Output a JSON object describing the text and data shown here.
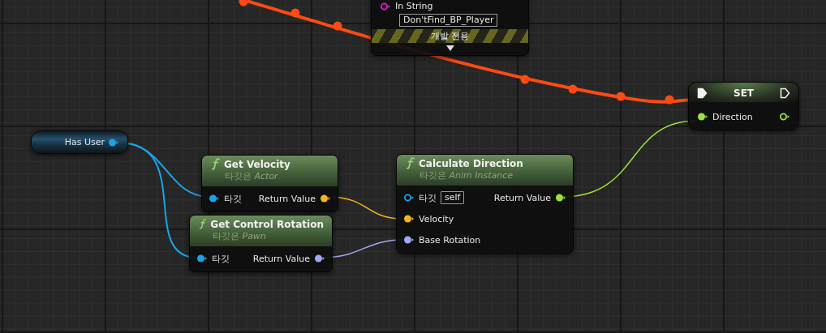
{
  "nodes": [
    {
      "kind": "debug",
      "pin": {
        "label": "In String",
        "color": "#e01ad0",
        "connected": false
      },
      "value": "Don'tFind_BP_Player",
      "banner": "개발 전용"
    },
    {
      "kind": "set",
      "title": "SET",
      "exec_in": {
        "connected": true
      },
      "exec_out": {
        "connected": false
      },
      "pins": [
        {
          "label": "Direction",
          "color": "#9be33a",
          "connected": true,
          "out_connected": false
        }
      ]
    },
    {
      "kind": "variable",
      "title": "Has User",
      "pin": {
        "color": "#1aa3e8",
        "connected": true
      }
    },
    {
      "kind": "function",
      "title": "Get Velocity",
      "subtitle": "타깃은 *Actor*",
      "inputs": [
        {
          "label": "타깃",
          "color": "#1aa3e8",
          "connected": true
        }
      ],
      "outputs": [
        {
          "label": "Return Value",
          "color": "#f5b619",
          "connected": true
        }
      ]
    },
    {
      "kind": "function",
      "title": "Get Control Rotation",
      "subtitle": "타깃은 *Pawn*",
      "inputs": [
        {
          "label": "타깃",
          "color": "#1aa3e8",
          "connected": true
        }
      ],
      "outputs": [
        {
          "label": "Return Value",
          "color": "#9fa8f0",
          "connected": true
        }
      ]
    },
    {
      "kind": "function",
      "title": "Calculate Direction",
      "subtitle": "타깃은 *Anim Instance*",
      "inputs": [
        {
          "label": "타깃",
          "color": "#1aa3e8",
          "connected": false,
          "value": "self"
        },
        {
          "label": "Velocity",
          "color": "#f5b619",
          "connected": true
        },
        {
          "label": "Base Rotation",
          "color": "#9fa8f0",
          "connected": true
        }
      ],
      "outputs": [
        {
          "label": "Return Value",
          "color": "#9be33a",
          "connected": true
        }
      ]
    }
  ]
}
